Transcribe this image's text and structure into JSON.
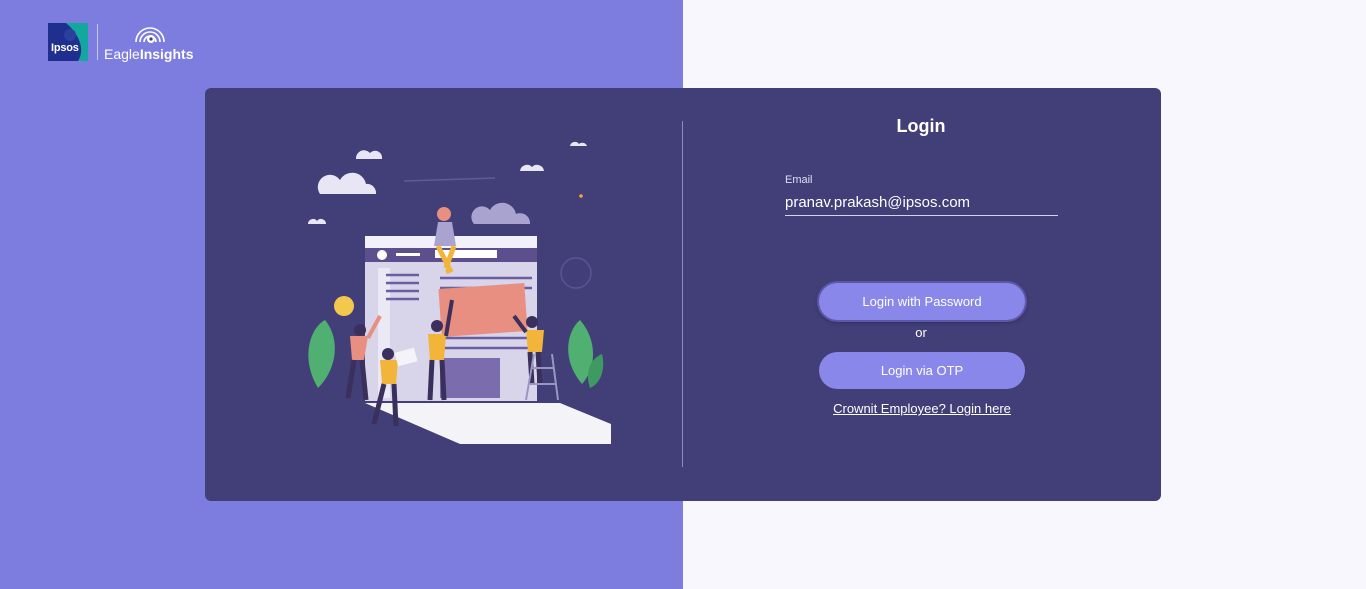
{
  "brand": {
    "ipsos": "Ipsos",
    "product_light": "Eagle",
    "product_bold": "Insights",
    "colors": {
      "left_bg": "#7d7de0",
      "card": "#413e78",
      "button": "#8a87ea",
      "right_bg": "#f8f7fd"
    }
  },
  "login": {
    "title": "Login",
    "email_label": "Email",
    "email_value": "pranav.prakash@ipsos.com",
    "password_button": "Login with Password",
    "or_text": "or",
    "otp_button": "Login via OTP",
    "crownit_link": "Crownit Employee? Login here"
  },
  "icons": [
    "ipsos-logo-icon",
    "eagle-signal-icon",
    "team-website-illustration"
  ]
}
